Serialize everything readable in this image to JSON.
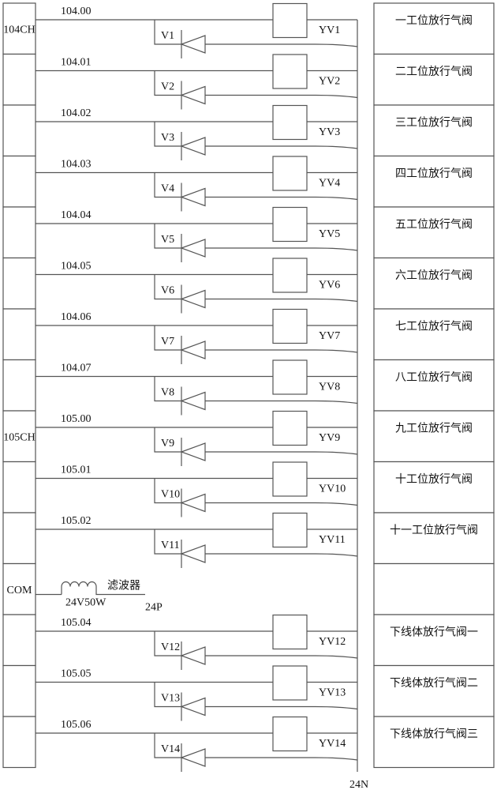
{
  "plc_modules": [
    {
      "label": "104CH",
      "row": 0
    },
    {
      "label": "105CH",
      "row": 8
    },
    {
      "label": "COM",
      "row": 11
    }
  ],
  "rows": [
    {
      "address": "104.00",
      "diode": "V1",
      "coil": "YV1",
      "description": "一工位放行气阀"
    },
    {
      "address": "104.01",
      "diode": "V2",
      "coil": "YV2",
      "description": "二工位放行气阀"
    },
    {
      "address": "104.02",
      "diode": "V3",
      "coil": "YV3",
      "description": "三工位放行气阀"
    },
    {
      "address": "104.03",
      "diode": "V4",
      "coil": "YV4",
      "description": "四工位放行气阀"
    },
    {
      "address": "104.04",
      "diode": "V5",
      "coil": "YV5",
      "description": "五工位放行气阀"
    },
    {
      "address": "104.05",
      "diode": "V6",
      "coil": "YV6",
      "description": "六工位放行气阀"
    },
    {
      "address": "104.06",
      "diode": "V7",
      "coil": "YV7",
      "description": "七工位放行气阀"
    },
    {
      "address": "104.07",
      "diode": "V8",
      "coil": "YV8",
      "description": "八工位放行气阀"
    },
    {
      "address": "105.00",
      "diode": "V9",
      "coil": "YV9",
      "description": "九工位放行气阀"
    },
    {
      "address": "105.01",
      "diode": "V10",
      "coil": "YV10",
      "description": "十工位放行气阀"
    },
    {
      "address": "105.02",
      "diode": "V11",
      "coil": "YV11",
      "description": "十一工位放行气阀"
    },
    {
      "address": "",
      "diode": "",
      "coil": "",
      "description": ""
    },
    {
      "address": "105.04",
      "diode": "V12",
      "coil": "YV12",
      "description": "下线体放行气阀一"
    },
    {
      "address": "105.05",
      "diode": "V13",
      "coil": "YV13",
      "description": "下线体放行气阀二"
    },
    {
      "address": "105.06",
      "diode": "V14",
      "coil": "YV14",
      "description": "下线体放行气阀三"
    }
  ],
  "com_row": {
    "transformer_label": "滤波器",
    "transformer_rating": "24V50W",
    "positive_label": "24P"
  },
  "negative_bus_label": "24N"
}
